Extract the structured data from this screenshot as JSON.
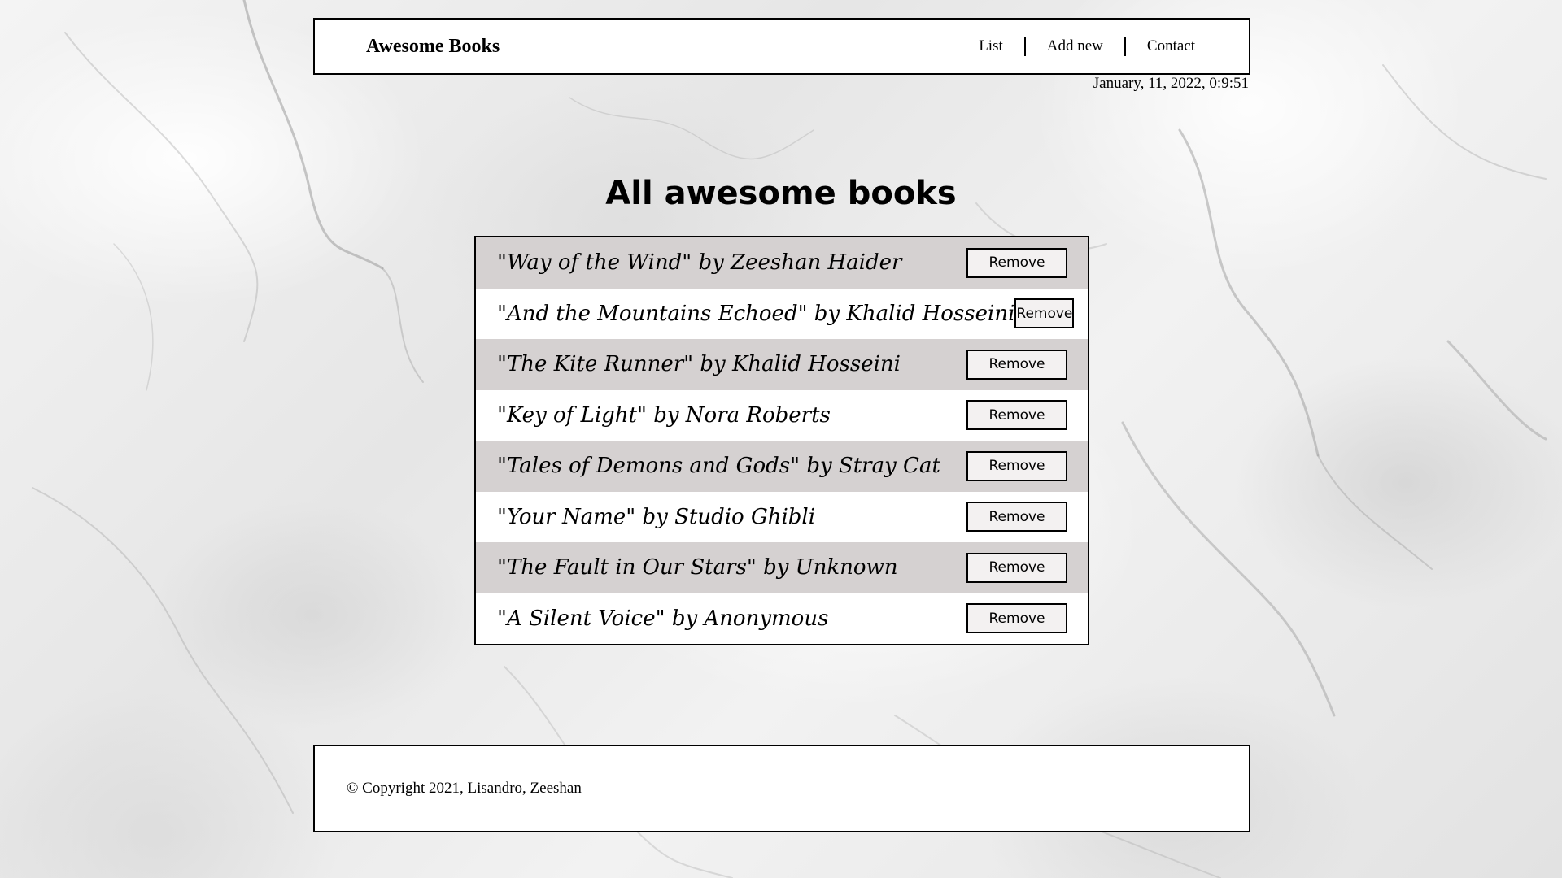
{
  "header": {
    "brand": "Awesome Books",
    "nav": [
      {
        "label": "List"
      },
      {
        "label": "Add new"
      },
      {
        "label": "Contact"
      }
    ]
  },
  "date": "January, 11, 2022, 0:9:51",
  "main": {
    "title": "All awesome books",
    "remove_label": "Remove",
    "books": [
      {
        "text": "\"Way of the Wind\" by  Zeeshan Haider"
      },
      {
        "text": "\"And the Mountains Echoed\" by  Khalid Hosseini"
      },
      {
        "text": "\"The Kite Runner\" by  Khalid Hosseini"
      },
      {
        "text": "\"Key of Light\" by  Nora Roberts"
      },
      {
        "text": "\"Tales of Demons and Gods\" by  Stray Cat"
      },
      {
        "text": "\"Your Name\" by  Studio Ghibli"
      },
      {
        "text": "\"The Fault in Our Stars\" by  Unknown"
      },
      {
        "text": "\"A Silent Voice\" by  Anonymous"
      }
    ]
  },
  "footer": {
    "copyright": "© Copyright 2021, Lisandro, Zeeshan"
  },
  "colors": {
    "row_shaded": "#d5d1d1",
    "row_plain": "#ffffff",
    "border": "#000000",
    "button_bg": "#f3f1f1"
  }
}
